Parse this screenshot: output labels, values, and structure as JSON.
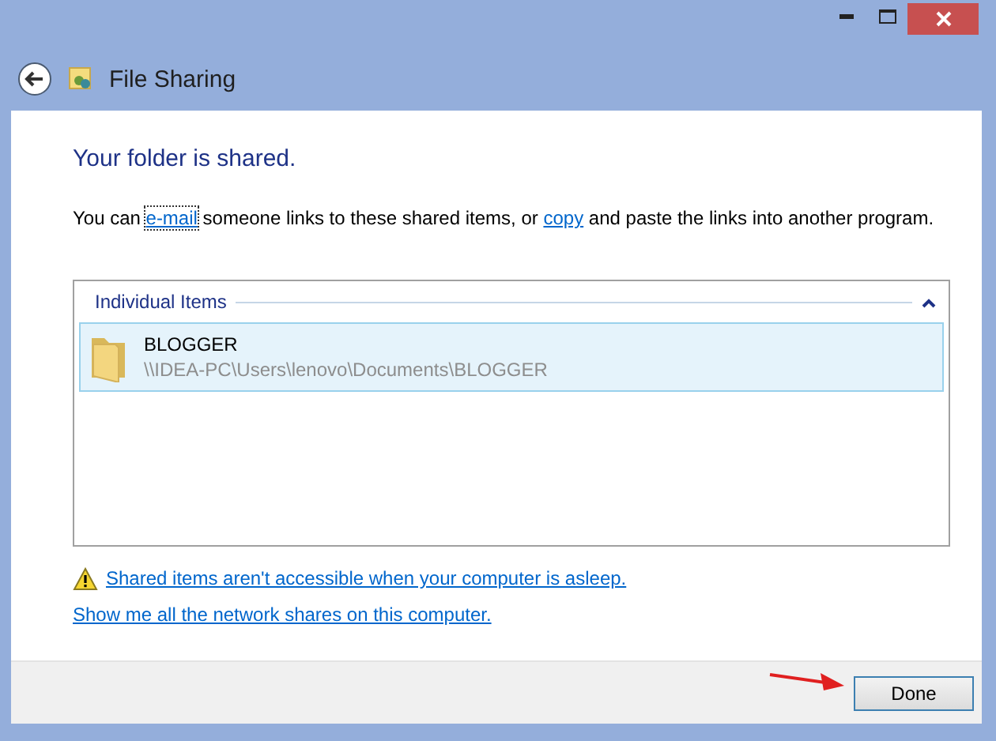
{
  "window": {
    "title": "File Sharing"
  },
  "heading": "Your folder is shared.",
  "sentence": [
    {
      "kind": "text",
      "text": "You can "
    },
    {
      "kind": "link",
      "text": "e-mail",
      "focused": true
    },
    {
      "kind": "text",
      "text": " someone links to these shared items, or "
    },
    {
      "kind": "link",
      "text": "copy",
      "focused": false
    },
    {
      "kind": "text",
      "text": " and paste the links into another program."
    }
  ],
  "group": {
    "title": "Individual Items",
    "expanded": true,
    "items": [
      {
        "name": "BLOGGER",
        "path": "\\\\IDEA-PC\\Users\\lenovo\\Documents\\BLOGGER",
        "selected": true
      }
    ]
  },
  "links": [
    {
      "kind": "warning",
      "text": "Shared items aren't accessible when your computer is asleep."
    },
    {
      "kind": "plain",
      "text": "Show me all the network shares on this computer."
    }
  ],
  "buttons": [
    "Done"
  ]
}
